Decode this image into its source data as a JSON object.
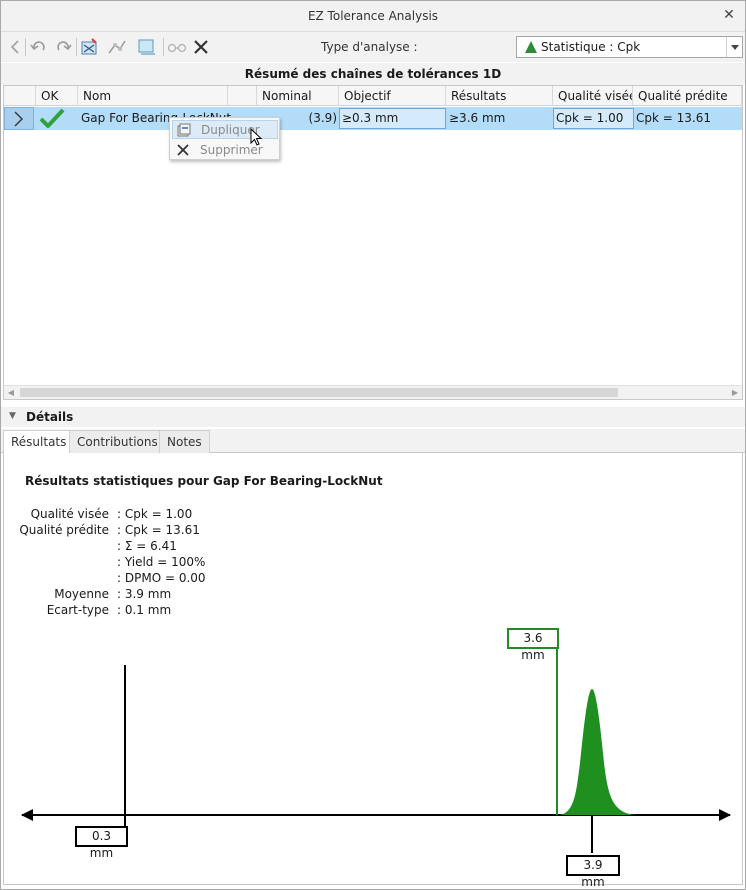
{
  "window": {
    "title": "EZ Tolerance Analysis"
  },
  "toolbar": {
    "analysis_label": "Type d'analyse :",
    "analysis_type": "Statistique : Cpk"
  },
  "summary": {
    "title": "Résumé des chaînes de tolérances 1D",
    "columns": [
      "OK",
      "Nom",
      "Nominal",
      "Objectif",
      "Résultats",
      "Qualité visée",
      "Qualité prédite"
    ],
    "rows": [
      {
        "name": "Gap For Bearing-LockNut",
        "nominal": "(3.9)",
        "objectif": "≥0.3 mm",
        "resultats": "≥3.6 mm",
        "qualite_visee": "Cpk = 1.00",
        "qualite_predite": "Cpk = 13.61"
      }
    ]
  },
  "context_menu": {
    "items": [
      {
        "label": "Dupliquer",
        "icon": "duplicate-icon"
      },
      {
        "label": "Supprimer",
        "icon": "delete-icon"
      }
    ]
  },
  "details": {
    "title": "Détails",
    "tabs": [
      "Résultats",
      "Contributions",
      "Notes"
    ],
    "active_tab": "Résultats"
  },
  "results": {
    "title": "Résultats statistiques pour Gap For Bearing-LockNut",
    "stats": [
      {
        "label": "Qualité visée",
        "value": ": Cpk = 1.00"
      },
      {
        "label": "Qualité prédite",
        "value": ": Cpk = 13.61"
      },
      {
        "label": "",
        "value": ": Σ = 6.41"
      },
      {
        "label": "",
        "value": ": Yield = 100%"
      },
      {
        "label": "",
        "value": ": DPMO = 0.00"
      },
      {
        "label": "Moyenne",
        "value": ": 3.9 mm"
      },
      {
        "label": "Ecart-type",
        "value": ": 0.1 mm"
      }
    ],
    "tags": {
      "objective": "0.3 mm",
      "min_result": "3.6 mm",
      "mean": "3.9 mm"
    }
  },
  "colors": {
    "selected_row": "#b3dcf8",
    "ok_check": "#2ea33a",
    "distribution": "#1f8f1f"
  }
}
